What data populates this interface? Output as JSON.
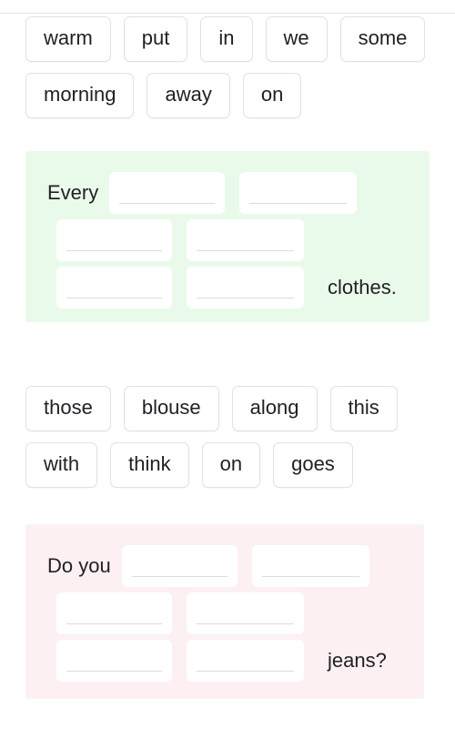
{
  "page": {
    "background_color": "#ffffff",
    "divider_color": "#e4e5e7"
  },
  "exercises": [
    {
      "id": "exercise-1",
      "panel_color": "#eafaea",
      "word_bank": {
        "name": "word-bank-1",
        "chips": [
          "warm",
          "put",
          "in",
          "we",
          "some",
          "morning",
          "away",
          "on"
        ]
      },
      "sentence": {
        "lead_text": "Every",
        "tail_text": "clothes.",
        "blank_count": 6,
        "rows": [
          {
            "lead": "Every",
            "blanks": 2,
            "tail": ""
          },
          {
            "lead": "",
            "blanks": 2,
            "tail": ""
          },
          {
            "lead": "",
            "blanks": 2,
            "tail": "clothes."
          }
        ]
      }
    },
    {
      "id": "exercise-2",
      "panel_color": "#fcf0f3",
      "word_bank": {
        "name": "word-bank-2",
        "chips": [
          "those",
          "blouse",
          "along",
          "this",
          "with",
          "think",
          "on",
          "goes"
        ]
      },
      "sentence": {
        "lead_text": "Do you",
        "tail_text": "jeans?",
        "blank_count": 6,
        "rows": [
          {
            "lead": "Do you",
            "blanks": 2,
            "tail": ""
          },
          {
            "lead": "",
            "blanks": 2,
            "tail": ""
          },
          {
            "lead": "",
            "blanks": 2,
            "tail": "jeans?"
          }
        ]
      }
    }
  ]
}
